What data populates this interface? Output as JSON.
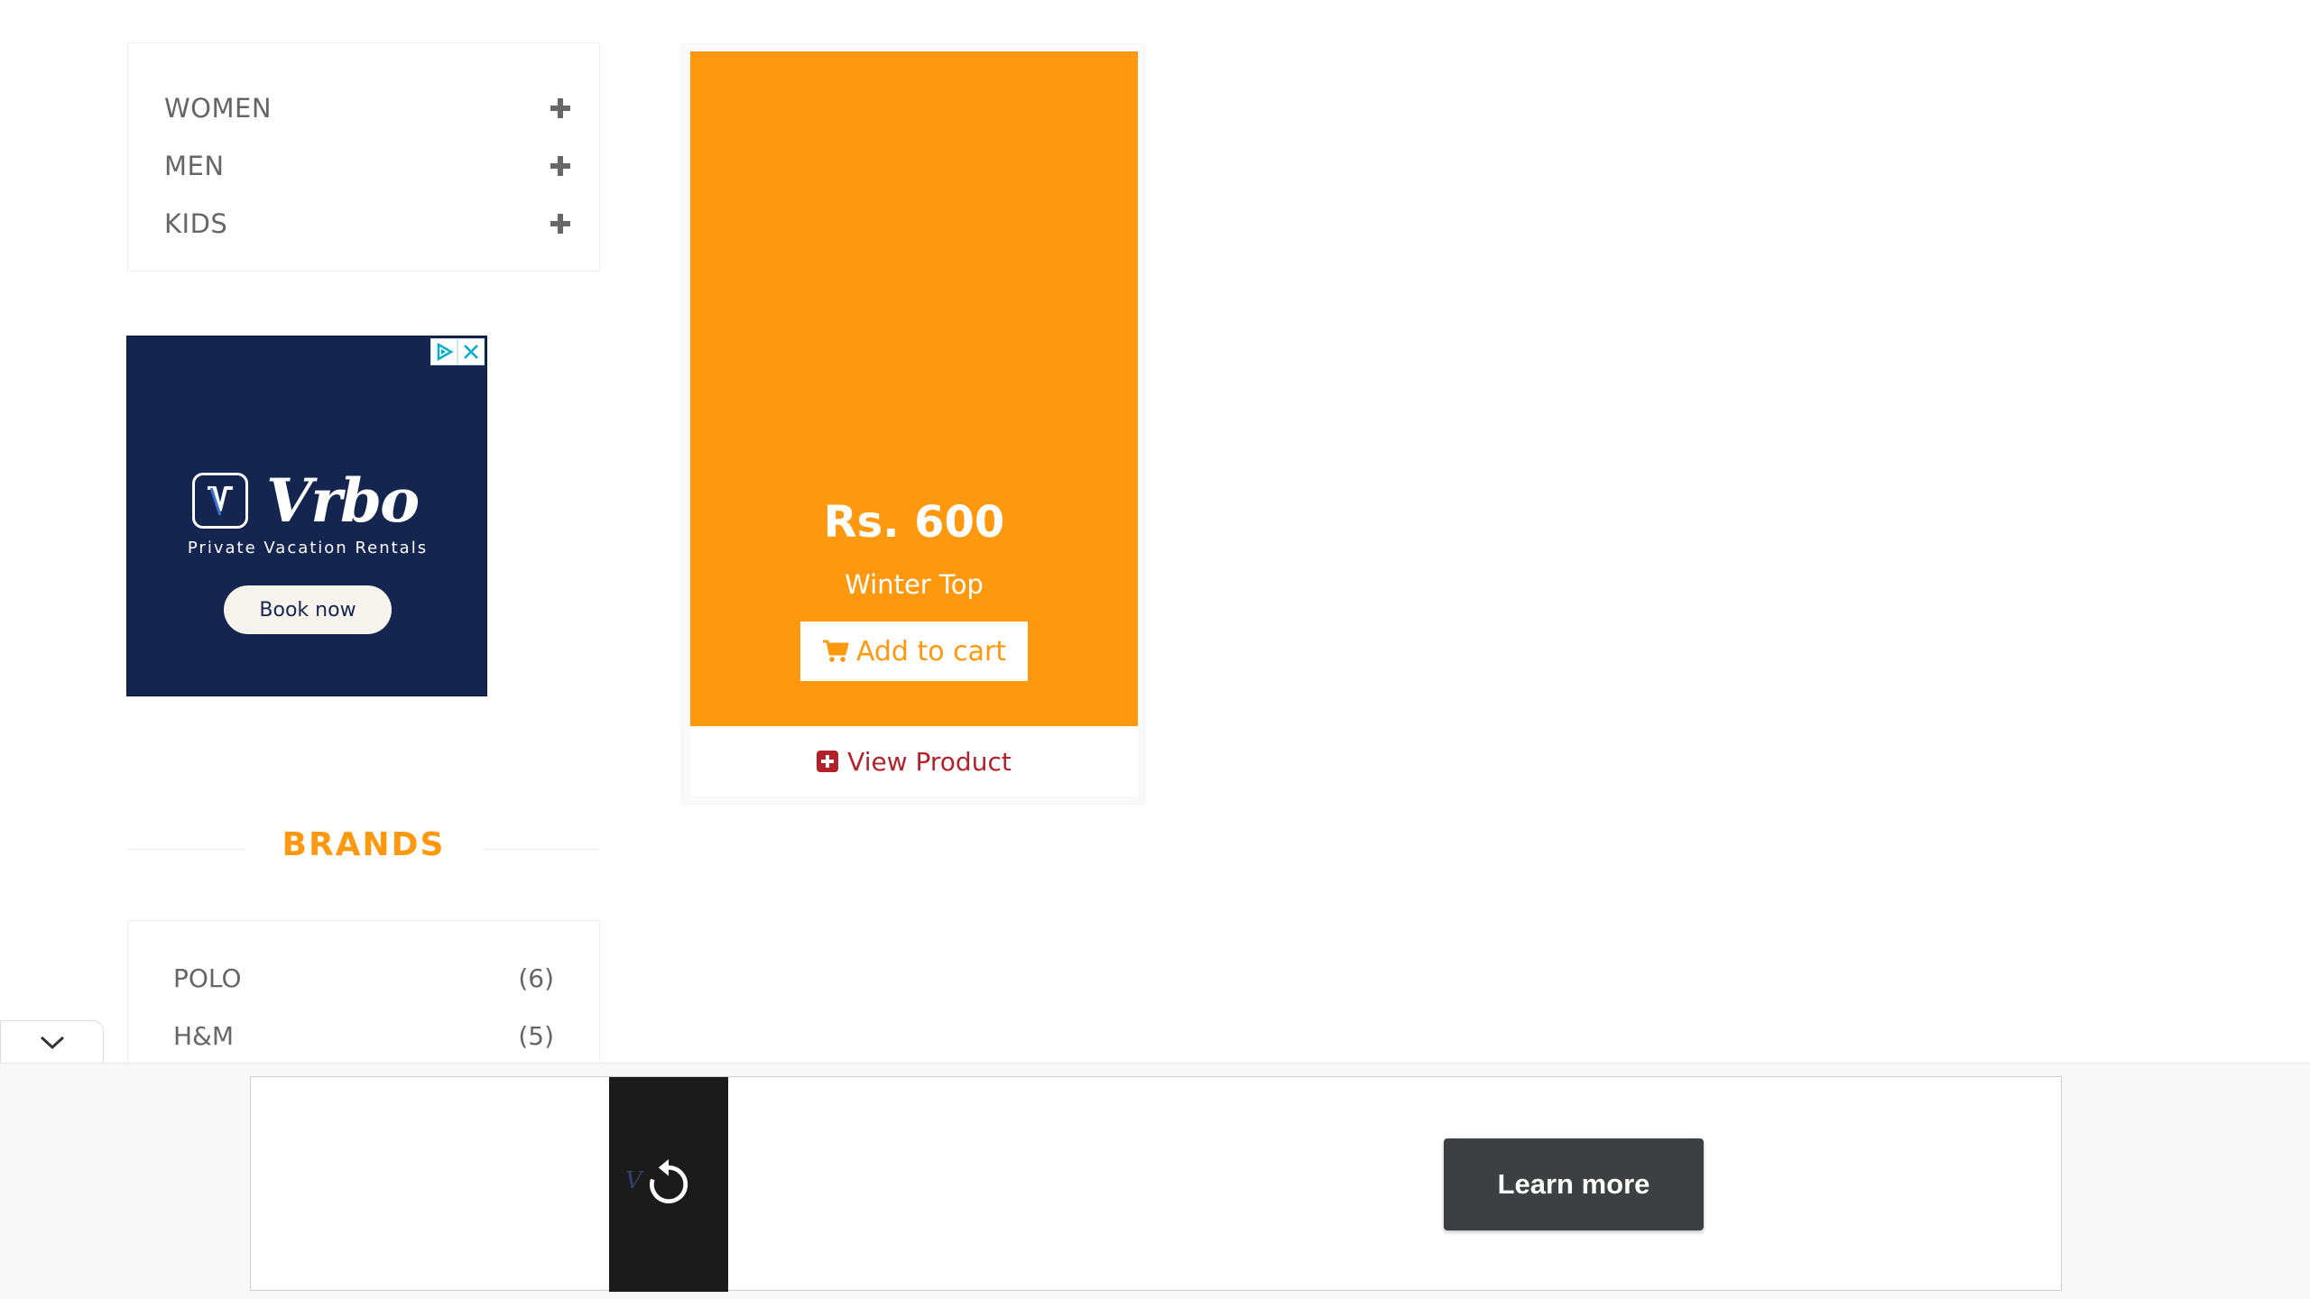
{
  "categories": [
    {
      "label": "WOMEN",
      "toggle_icon": "plus-icon"
    },
    {
      "label": "MEN",
      "toggle_icon": "plus-icon"
    },
    {
      "label": "KIDS",
      "toggle_icon": "plus-icon"
    }
  ],
  "side_ad": {
    "brand": "Vrbo",
    "tagline": "Private Vacation Rentals",
    "cta": "Book now",
    "background_color": "#142550"
  },
  "brands": {
    "heading": "BRANDS",
    "items": [
      {
        "name": "POLO",
        "count": "(6)"
      },
      {
        "name": "H&M",
        "count": "(5)"
      }
    ]
  },
  "product": {
    "price": "Rs. 600",
    "name": "Winter Top",
    "add_to_cart_label": "Add to cart",
    "view_product_label": "View Product",
    "accent_color": "#fe980f"
  },
  "anchor_ad": {
    "cta": "Learn more",
    "collapse_icon": "chevron-down-icon",
    "replay_icon": "replay-icon"
  }
}
